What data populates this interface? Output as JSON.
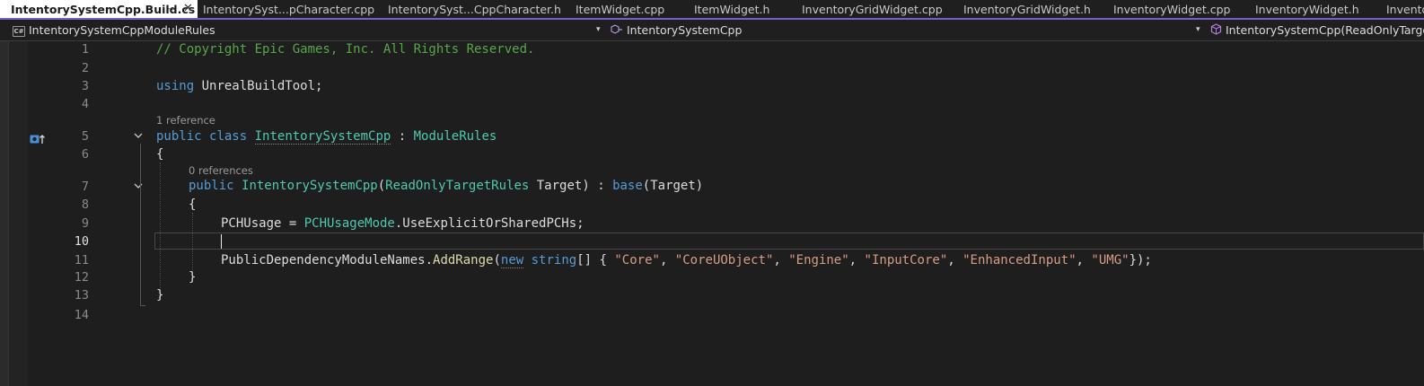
{
  "tabs": [
    {
      "label": "IntentorySystemCpp.Build.cs",
      "active": true
    },
    {
      "label": "IntentorySyst...pCharacter.cpp"
    },
    {
      "label": "IntentorySyst...CppCharacter.h"
    },
    {
      "label": "ItemWidget.cpp"
    },
    {
      "label": "ItemWidget.h"
    },
    {
      "label": "InventoryGridWidget.cpp"
    },
    {
      "label": "InventoryGridWidget.h"
    },
    {
      "label": "InventoryWidget.cpp"
    },
    {
      "label": "InventoryWidget.h"
    },
    {
      "label": "Inventory"
    }
  ],
  "tab_pin_glyph": "⊸",
  "tab_close_glyph": "✕",
  "nav": {
    "project": "IntentorySystemCppModuleRules",
    "class": "IntentorySystemCpp",
    "member": "IntentorySystemCpp(ReadOnlyTargetRules Target)"
  },
  "icons": {
    "project_badge": "C#",
    "class_icon": "class-icon",
    "member_icon": "method-cube-icon",
    "dropdown": "▾"
  },
  "editor": {
    "line_numbers": [
      "1",
      "2",
      "3",
      "4",
      "5",
      "6",
      "7",
      "8",
      "9",
      "10",
      "11",
      "12",
      "13",
      "14"
    ],
    "current_line": "10",
    "code_lens": {
      "class_refs": "1 reference",
      "ctor_refs": "0 references"
    },
    "code": {
      "l1_comment": "// Copyright Epic Games, Inc. All Rights Reserved.",
      "l3_using": "using",
      "l3_ns": "UnrealBuildTool;",
      "l5_public": "public",
      "l5_class": "class",
      "l5_name": "IntentorySystemCpp",
      "l5_colon": " : ",
      "l5_base": "ModuleRules",
      "l6": "{",
      "l7_public": "public",
      "l7_name": "IntentorySystemCpp",
      "l7_open": "(",
      "l7_ptype": "ReadOnlyTargetRules",
      "l7_pname": " Target",
      "l7_close": ") : ",
      "l7_base": "base",
      "l7_args": "(Target)",
      "l8": "{",
      "l9_lhs": "PCHUsage = ",
      "l9_type": "PCHUsageMode",
      "l9_rhs": ".UseExplicitOrSharedPCHs;",
      "l11_a": "PublicDependencyModuleNames.",
      "l11_method": "AddRange",
      "l11_open": "(",
      "l11_new": "new",
      "l11_sp": " ",
      "l11_string": "string",
      "l11_b": "[] { ",
      "s1": "\"Core\"",
      "s2": "\"CoreUObject\"",
      "s3": "\"Engine\"",
      "s4": "\"InputCore\"",
      "s5": "\"EnhancedInput\"",
      "s6": "\"UMG\"",
      "comma": ", ",
      "l11_end": "});",
      "l12": "}",
      "l13": "}"
    }
  },
  "colors": {
    "keyword": "#569cd6",
    "type": "#4ec9b0",
    "string": "#d69d85",
    "comment": "#57a64a",
    "accent": "#7a5fc8"
  }
}
